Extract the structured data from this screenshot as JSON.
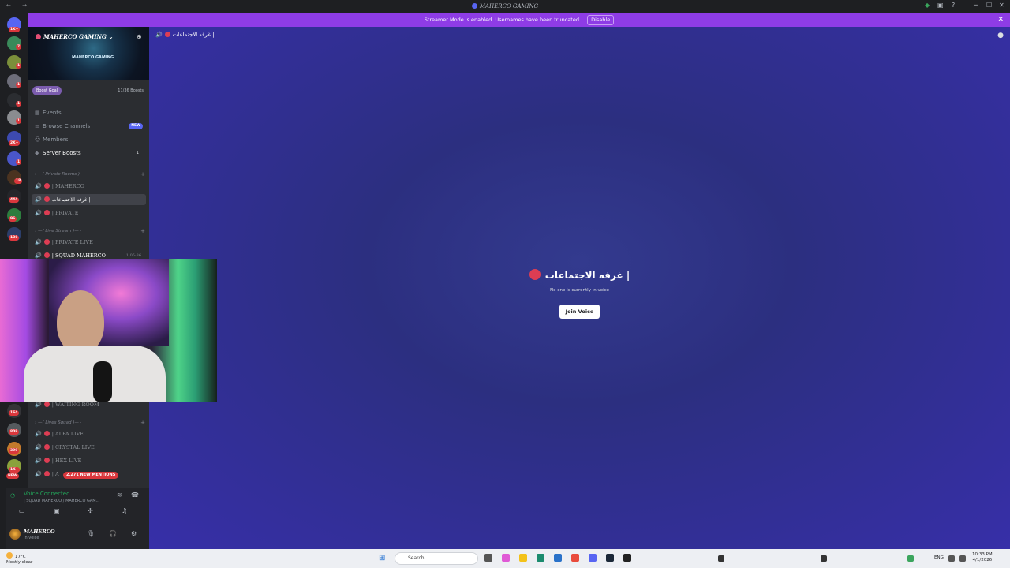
{
  "titlebar": {
    "title": "MAHERCO GAMING",
    "nav": "← →"
  },
  "window_controls": {
    "minimize": "─",
    "maximize": "☐",
    "close": "✕"
  },
  "banner": {
    "text": "Streamer Mode is enabled. Usernames have been truncated.",
    "disable_label": "Disable",
    "close": "✕"
  },
  "server_badges": [
    "1K+",
    "7",
    "1",
    "1",
    "1",
    "1",
    "2K+",
    "1",
    "18",
    "444",
    "96",
    "136",
    "164",
    "808",
    "399",
    "1K+",
    "NEW"
  ],
  "server": {
    "name": "MAHERCO GAMING",
    "logo_text": "MAHERCO GAMING",
    "boost_label": "Boost Goal",
    "boost_count": "11/36 Boosts",
    "menu": [
      {
        "label": "Events",
        "icon": "calendar-icon"
      },
      {
        "label": "Browse Channels",
        "icon": "browse-icon",
        "badge": "NEW"
      },
      {
        "label": "Members",
        "icon": "members-icon"
      },
      {
        "label": "Server Boosts",
        "icon": "boost-icon",
        "count": "1"
      }
    ]
  },
  "categories": [
    {
      "label": "Private Rooms"
    },
    {
      "label": "Live Stream"
    },
    {
      "label": "Lives Squad"
    }
  ],
  "channels": {
    "private": [
      "| MAHERCO",
      "غرفه الاجتماعات |",
      "| PRIVATE"
    ],
    "live": [
      "| PRIVATE LIVE",
      "| SQUAD MAHERCO"
    ],
    "live_time": "1:05:36",
    "waiting": "| WAITING ROOM",
    "squad": [
      "| ALFA LIVE",
      "| CRYSTAL LIVE",
      "| HEX LIVE",
      "| A"
    ]
  },
  "mentions_pill": "2,271 NEW MENTIONS",
  "voice_panel": {
    "status": "Voice Connected",
    "channel": "| SQUAD MAHERCO / MAHERCO GAM...",
    "username": "MAHERCO",
    "user_status": "In voice"
  },
  "main": {
    "header_channel": "غرفه الاجتماعات |",
    "title": "غرفه الاجتماعات |",
    "subtitle": "No one is currently in voice",
    "join_label": "Join Voice"
  },
  "taskbar": {
    "temp": "17°C",
    "weather": "Mostly clear",
    "search_placeholder": "Search",
    "lang": "ENG",
    "time": "10:33 PM",
    "date": "4/1/2026"
  }
}
